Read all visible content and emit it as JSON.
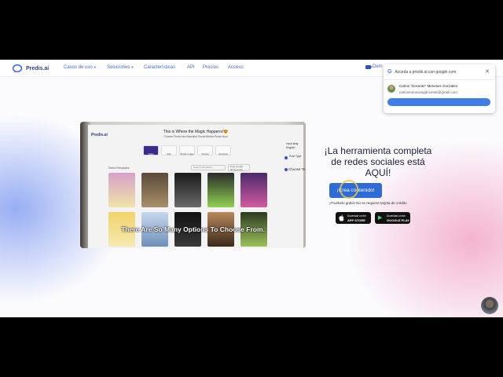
{
  "nav": {
    "logo_text": "Predis.ai",
    "items": [
      "Casos de uso",
      "Soluciones",
      "Características",
      "API",
      "Precios",
      "Acceso"
    ],
    "demo_label": "Dem"
  },
  "google_popup": {
    "title": "Acceda a predis.ai con google.com",
    "name": "Carlos \"Docente\" Meneses Gonzales",
    "email": "carlosmenesesgdocente@gmail.com",
    "continue_label": "",
    "close": "✕",
    "logo_letter": "G"
  },
  "video": {
    "screen_logo": "Predis.ai",
    "screen_title": "This is Where the Magic Happens!😍",
    "screen_subtitle": "Convert Texts into Beautiful Social Media Posts Now",
    "screen_tabs": [
      "Video",
      "Ads",
      "Single Image",
      "Stories",
      "Carousel"
    ],
    "screen_lang_label": "Input lang",
    "screen_lang_value": "English",
    "screen_create_label": "Post Type",
    "screen_choose": "Choose Te",
    "screen_filter": "Select Templates",
    "screen_search": "Search Templates",
    "screen_select_label": "Post Length",
    "screen_select_value": "30 Seconds",
    "subtitle": "There Are So Many Options To Choose From."
  },
  "hero": {
    "title": "¡La herramienta completa de redes sociales está AQUÍ!",
    "cta_label": "¡Crea contenido!",
    "trial_text": "¡Pruébelo gratis! No se requiere tarjeta de crédito"
  },
  "stores": [
    {
      "line1": "Download on the",
      "line2": "APP STORE",
      "icon": ""
    },
    {
      "line1": "Download on the",
      "line2": "GOOGLE PLAY",
      "icon": "▶"
    }
  ],
  "colors": {
    "primary": "#2f6bd8",
    "nav_link": "#4a67c9",
    "logo": "#2c3e8c",
    "hero_text": "#1c1c3a",
    "google_button": "#3f7ee9"
  }
}
